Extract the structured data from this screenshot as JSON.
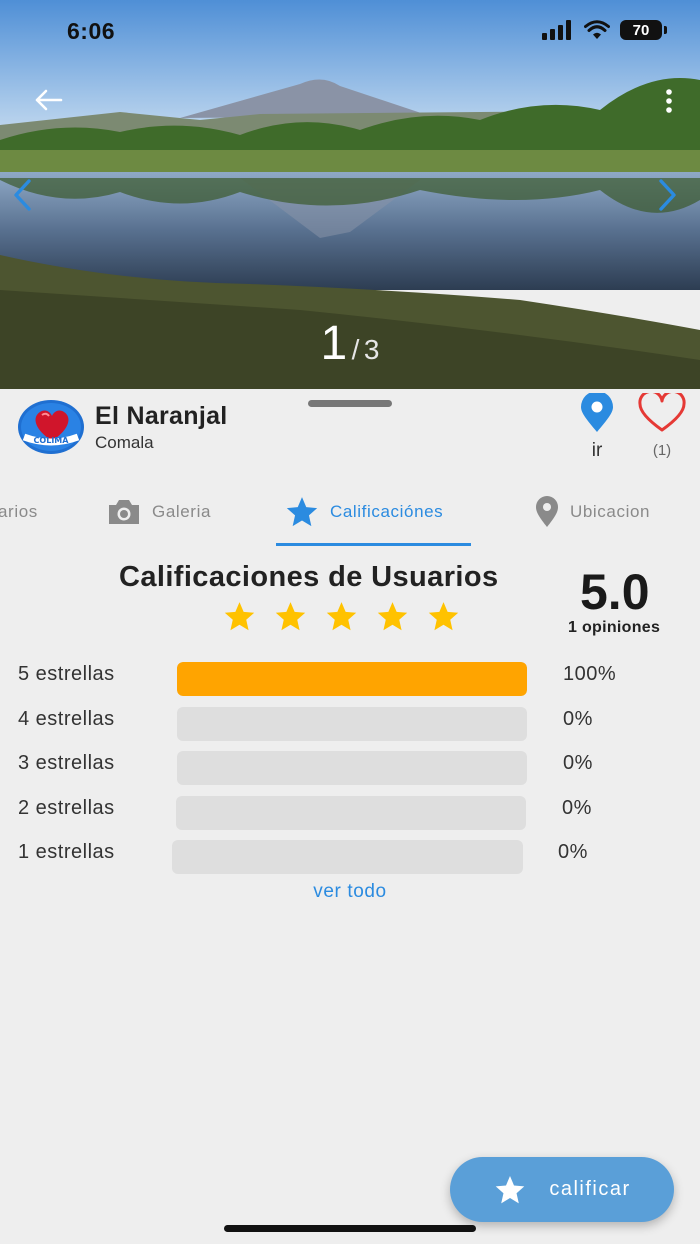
{
  "status_bar": {
    "time": "6:06",
    "battery": "70"
  },
  "gallery": {
    "current": "1",
    "separator": "/",
    "total": "3"
  },
  "place": {
    "name": "El Naranjal",
    "location": "Comala",
    "logo_text": "COLIMA"
  },
  "actions": {
    "go_label": "ir",
    "favorites_count": "(1)"
  },
  "tabs": [
    {
      "label": "Comentarios",
      "visible_label": "arios",
      "icon": "comment-icon",
      "active": false
    },
    {
      "label": "Galeria",
      "icon": "camera-icon",
      "active": false
    },
    {
      "label": "Calificaciónes",
      "icon": "star-icon",
      "active": true
    },
    {
      "label": "Ubicacion",
      "icon": "location-pin-icon",
      "active": false
    }
  ],
  "ratings": {
    "title": "Calificaciones de Usuarios",
    "score": "5.0",
    "opinions": "1 opiniones",
    "stars_filled": 5,
    "distribution": [
      {
        "label": "5 estrellas",
        "percent_text": "100%",
        "fraction": 1.0
      },
      {
        "label": "4 estrellas",
        "percent_text": "0%",
        "fraction": 0
      },
      {
        "label": "3 estrellas",
        "percent_text": "0%",
        "fraction": 0
      },
      {
        "label": "2 estrellas",
        "percent_text": "0%",
        "fraction": 0
      },
      {
        "label": "1 estrellas",
        "percent_text": "0%",
        "fraction": 0
      }
    ],
    "see_all": "ver todo"
  },
  "fab": {
    "label": "calificar",
    "icon": "star-icon"
  },
  "colors": {
    "accent": "#2b8be0",
    "bar_fill": "#ffa400",
    "star": "#ffc200",
    "heart": "#e53935",
    "fab": "#5a9fd8"
  }
}
